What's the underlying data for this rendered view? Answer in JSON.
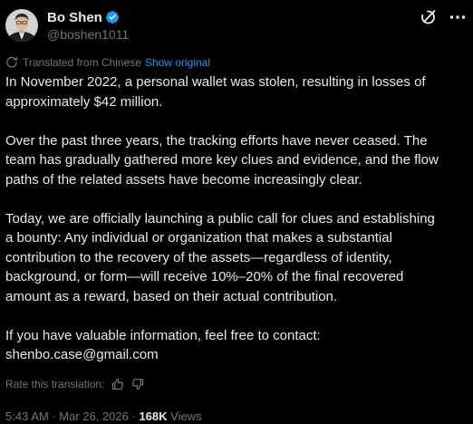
{
  "author": {
    "display_name": "Bo Shen",
    "handle": "@boshen1011"
  },
  "translation": {
    "label": "Translated from Chinese",
    "show_original": "Show original"
  },
  "post": {
    "paragraphs": [
      "In November 2022, a personal wallet was stolen, resulting in losses of\napproximately $42 million.",
      "Over the past three years, the tracking efforts have never ceased. The\nteam has gradually gathered more key clues and evidence, and the flow\npaths of the related assets have become increasingly clear.",
      "Today, we are officially launching a public call for clues and establishing\na bounty: Any individual or organization that makes a substantial\ncontribution to the recovery of the assets—regardless of identity,\nbackground, or form—will receive 10%–20% of the final recovered\namount as a reward, based on their actual contribution.",
      "If you have valuable information, feel free to contact:\nshenbo.case@gmail.com"
    ]
  },
  "rate": {
    "label": "Rate this translation:"
  },
  "meta": {
    "time": "5:43 AM",
    "separator": " · ",
    "date": "Mar 26, 2026",
    "views_count": "168K",
    "views_label": " Views"
  },
  "icons": {
    "grok": "grok-icon",
    "more": "more-options-icon",
    "verified": "verified-badge-icon",
    "globe": "translate-globe-icon",
    "thumbs_up": "thumbs-up-icon",
    "thumbs_down": "thumbs-down-icon"
  },
  "colors": {
    "background": "#000000",
    "text": "#e7e9ea",
    "secondary": "#71767b",
    "accent": "#1d9bf0"
  }
}
